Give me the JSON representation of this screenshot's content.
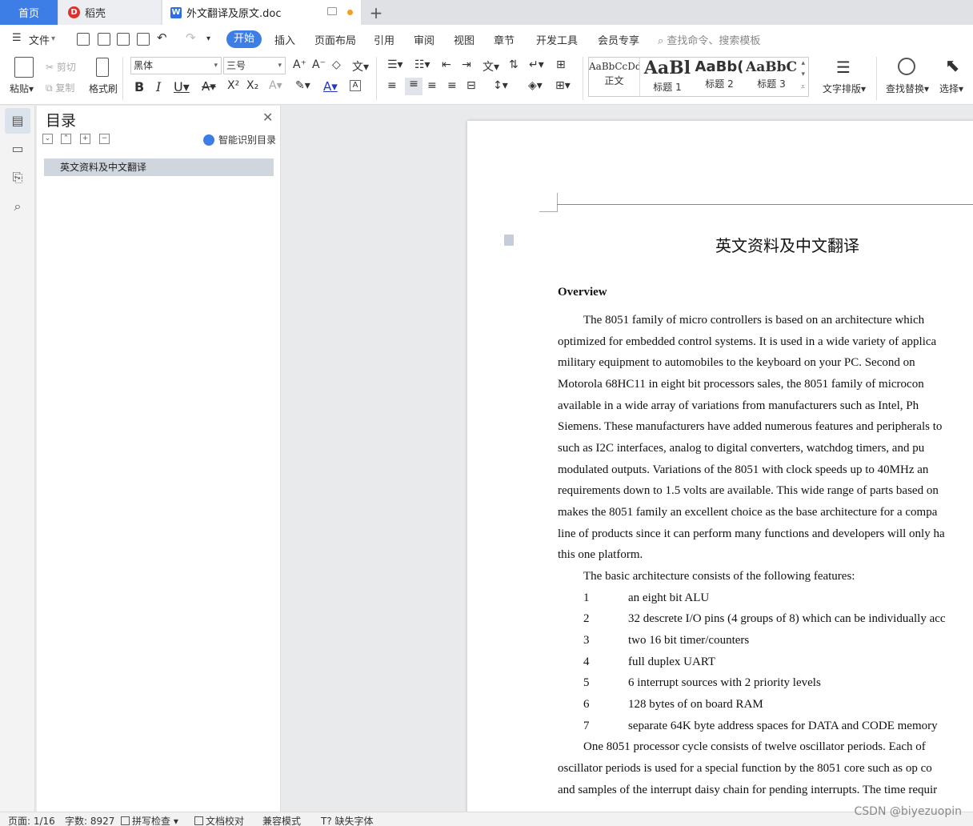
{
  "tabs": {
    "home": "首页",
    "daoke": "稻壳",
    "doc": "外文翻译及原文.doc",
    "add": "+"
  },
  "menu": {
    "file": "文件",
    "start": "开始",
    "insert": "插入",
    "layout": "页面布局",
    "ref": "引用",
    "review": "审阅",
    "view": "视图",
    "chapter": "章节",
    "dev": "开发工具",
    "member": "会员专享",
    "search": "查找命令、搜索模板"
  },
  "ribbon": {
    "paste": "粘贴",
    "cut": "剪切",
    "copy": "复制",
    "format_painter": "格式刷",
    "font": "黑体",
    "size": "三号",
    "styles": [
      {
        "sample": "AaBbCcDd",
        "name": "正文"
      },
      {
        "sample": "AaBl",
        "name": "标题 1"
      },
      {
        "sample": "AaBb(",
        "name": "标题 2"
      },
      {
        "sample": "AaBbC",
        "name": "标题 3"
      }
    ],
    "text_layout": "文字排版",
    "find_replace": "查找替换",
    "select": "选择"
  },
  "toc": {
    "title": "目录",
    "smart": "智能识别目录",
    "entry": "英文资料及中文翻译"
  },
  "doc": {
    "title": "英文资料及中文翻译",
    "heading": "Overview",
    "lines": [
      "The  8051  family  of  micro  controllers  is  based  on  an  architecture  which",
      "optimized  for  embedded  control  systems.  It  is  used  in  a  wide  variety  of  applica",
      "military  equipment  to  automobiles  to  the  keyboard  on  your  PC.  Second  on",
      "Motorola  68HC11  in  eight  bit  processors  sales,  the  8051  family  of  microcon",
      "available  in  a  wide  array  of  variations  from  manufacturers  such  as  Intel,  Ph",
      "Siemens.  These  manufacturers  have  added  numerous  features  and  peripherals  to",
      "such  as  I2C  interfaces,  analog  to  digital  converters,  watchdog  timers,  and  pu",
      "modulated  outputs.  Variations  of  the  8051  with  clock  speeds  up  to  40MHz  an",
      "requirements  down  to  1.5  volts  are  available.  This  wide  range  of  parts  based  on",
      "makes  the  8051  family  an  excellent  choice  as  the  base  architecture  for  a  compa",
      "line  of  products  since  it  can  perform  many  functions  and  developers  will  only  ha",
      "this  one  platform.",
      "The  basic  architecture  consists  of  the  following  features:"
    ],
    "list": [
      {
        "n": "1",
        "t": "an eight bit ALU"
      },
      {
        "n": "2",
        "t": "32 descrete I/O pins (4 groups of 8)    which can be individually acc"
      },
      {
        "n": "3",
        "t": "two 16 bit timer/counters"
      },
      {
        "n": "4",
        "t": "full duplex UART"
      },
      {
        "n": "5",
        "t": "6 interrupt sources with 2 priority levels"
      },
      {
        "n": "6",
        "t": "128 bytes of on board RAM"
      },
      {
        "n": "7",
        "t": "separate 64K byte address spaces for DATA and CODE memory"
      }
    ],
    "tail": [
      "One  8051  processor  cycle  consists  of  twelve  oscillator  periods.  Each  of",
      "oscillator  periods  is  used  for  a  special  function  by  the  8051  core  such  as  op  co",
      "and  samples  of  the  interrupt  daisy  chain  for  pending  interrupts.  The  time  requir"
    ]
  },
  "status": {
    "page": "页面: 1/16",
    "words": "字数: 8927",
    "spell": "拼写检查",
    "proof": "文档校对",
    "compat": "兼容模式",
    "missing_font": "缺失字体"
  },
  "watermark": "CSDN @biyezuopin"
}
